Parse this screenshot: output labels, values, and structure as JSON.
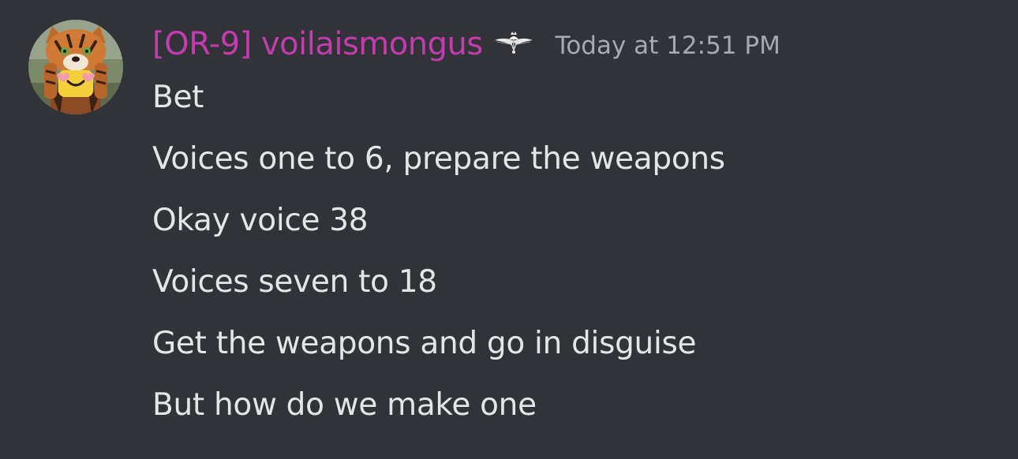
{
  "message": {
    "author": {
      "display_name": "[OR-9] voilaismongus",
      "name_color": "#c23cae",
      "avatar_icon": "avatar-tiger-hat-character",
      "role_icon": "winged-parachute-badge-icon"
    },
    "timestamp": "Today at 12:51 PM",
    "lines": [
      "Bet",
      "Voices one to 6, prepare the weapons",
      "Okay voice 38",
      "Voices seven to 18",
      "Get the weapons and go in disguise",
      "But how do we make one"
    ]
  },
  "colors": {
    "background": "#313338",
    "text": "#e3e5e8",
    "timestamp": "#a7a9ae"
  }
}
